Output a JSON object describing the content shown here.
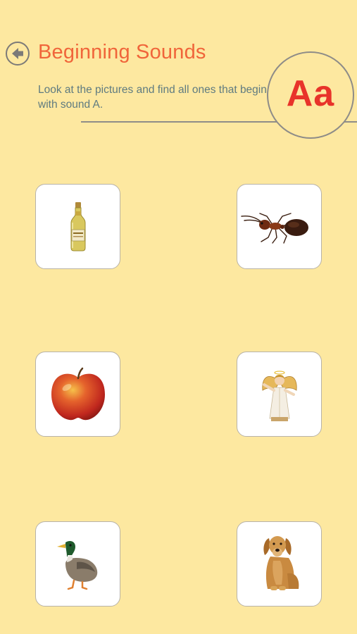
{
  "header": {
    "title": "Beginning Sounds",
    "instructions": "Look at the pictures and find all ones that begin with sound A.",
    "letter": "Aa",
    "back_icon": "back-arrow-icon"
  },
  "colors": {
    "background": "#FDE8A0",
    "title": "#F0653A",
    "instructions": "#5F7B80",
    "letter": "#E8332A",
    "card": "#FFFFFF"
  },
  "cards": [
    {
      "picture": "bottle"
    },
    {
      "picture": "ant"
    },
    {
      "picture": "apple"
    },
    {
      "picture": "angel"
    },
    {
      "picture": "duck"
    },
    {
      "picture": "dog"
    }
  ]
}
